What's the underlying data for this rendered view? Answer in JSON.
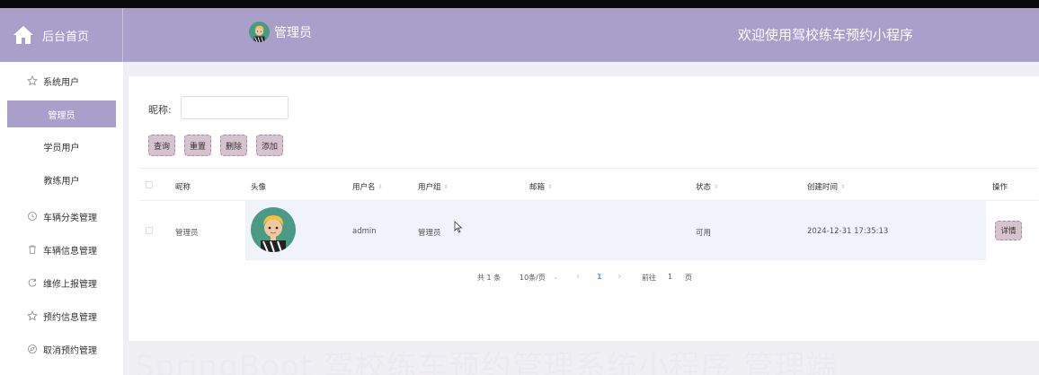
{
  "header": {
    "home_label": "后台首页",
    "admin_name": "管理员",
    "site_title": "欢迎使用驾校练车预约小程序",
    "bg_color": "#a89fca"
  },
  "sidebar": {
    "top": {
      "label": "系统用户",
      "icon": "star-icon"
    },
    "sub_items": [
      {
        "label": "管理员",
        "active": true
      },
      {
        "label": "学员用户",
        "active": false
      },
      {
        "label": "教练用户",
        "active": false
      }
    ],
    "categories": [
      {
        "label": "车辆分类管理",
        "icon": "clock-icon"
      },
      {
        "label": "车辆信息管理",
        "icon": "trash-icon"
      },
      {
        "label": "维修上报管理",
        "icon": "refresh-icon"
      },
      {
        "label": "预约信息管理",
        "icon": "star-icon"
      },
      {
        "label": "取消预约管理",
        "icon": "compass-icon"
      }
    ]
  },
  "search": {
    "label": "昵称:",
    "value": "",
    "placeholder": ""
  },
  "buttons": {
    "query": "查询",
    "reset": "重置",
    "delete": "删除",
    "add": "添加"
  },
  "table": {
    "headers": {
      "nickname": "昵称",
      "avatar": "头像",
      "username": "用户名",
      "group": "用户组",
      "email": "邮箱",
      "status": "状态",
      "created": "创建时间",
      "actions": "操作"
    },
    "rows": [
      {
        "nickname": "管理员",
        "username": "admin",
        "group": "管理员",
        "email": "",
        "status": "可用",
        "created": "2024-12-31 17:35:13",
        "action": "详情"
      }
    ]
  },
  "pagination": {
    "total": "共 1 条",
    "page_size": "10条/页",
    "current_page": "1",
    "goto_label": "前往",
    "goto_value": "1",
    "page_suffix": "页",
    "prev": "‹",
    "next": "›",
    "dropdown": "⌄"
  },
  "watermark": "SpringBoot 驾校练车预约管理系统小程序 管理端",
  "accent_color": "#d7c3cf"
}
